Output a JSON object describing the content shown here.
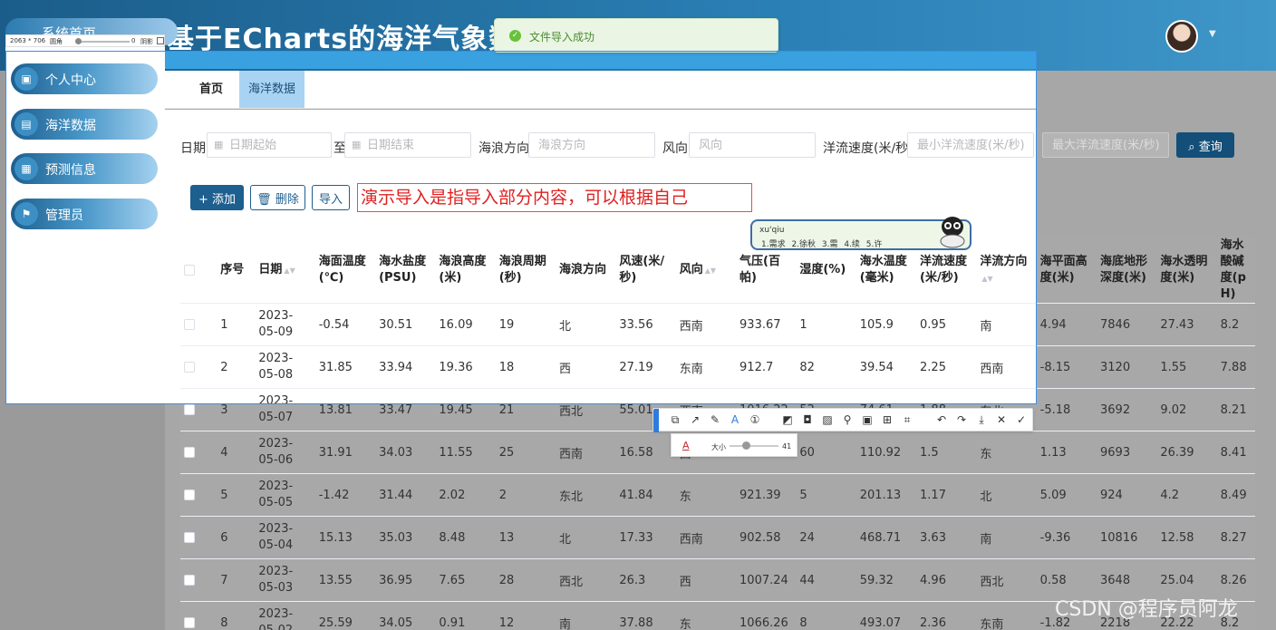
{
  "app": {
    "title": "基于ECharts的海洋气象数据",
    "title_suffix": "。"
  },
  "screenshot_tool": {
    "size_label": "2063 * 706",
    "round_label": "圆角",
    "round_value": "0",
    "shadow_label": "阴影",
    "brush_size_label": "大小",
    "brush_size_value": "41"
  },
  "toast": {
    "message": "文件导入成功",
    "color": "#67c23a"
  },
  "sidebar": {
    "home": "系统首页",
    "items": [
      {
        "label": "个人中心",
        "icon": "profile-icon"
      },
      {
        "label": "海洋数据",
        "icon": "clipboard-icon"
      },
      {
        "label": "预测信息",
        "icon": "grid-icon"
      },
      {
        "label": "管理员",
        "icon": "flag-icon"
      }
    ]
  },
  "tabs": [
    {
      "label": "首页",
      "active": false
    },
    {
      "label": "海洋数据",
      "active": true
    }
  ],
  "filters": {
    "date_label": "日期",
    "date_start_placeholder": "日期起始",
    "date_to": "至",
    "date_end_placeholder": "日期结束",
    "wave_dir_label": "海浪方向",
    "wave_dir_placeholder": "海浪方向",
    "wind_dir_label": "风向",
    "wind_dir_placeholder": "风向",
    "current_speed_label": "洋流速度(米/秒)",
    "min_current_placeholder": "最小洋流速度(米/秒)",
    "max_current_placeholder": "最大洋流速度(米/秒)",
    "query_button": "查询"
  },
  "actions": {
    "add": "添加",
    "delete": "删除",
    "import": "导入",
    "annotation": "演示导入是指导入部分内容，可以根据自己"
  },
  "ime": {
    "pinyin": "xu'qiu",
    "candidates": "1.需求  2.徐秋  3.需  4.续  5.许"
  },
  "table": {
    "headers": [
      "序号",
      "日期",
      "海面温度(℃)",
      "海水盐度(PSU)",
      "海浪高度(米)",
      "海浪周期(秒)",
      "海浪方向",
      "风速(米/秒)",
      "风向",
      "气压(百帕)",
      "湿度(%)",
      "海水温度(毫米)",
      "洋流速度(米/秒)",
      "洋流方向",
      "海平面高度(米)",
      "海底地形深度(米)",
      "海水透明度(米)",
      "海水酸碱度(pH)"
    ],
    "rows": [
      [
        "1",
        "2023-05-09",
        "-0.54",
        "30.51",
        "16.09",
        "19",
        "北",
        "33.56",
        "西南",
        "933.67",
        "1",
        "105.9",
        "0.95",
        "南",
        "4.94",
        "7846",
        "27.43",
        "8.2"
      ],
      [
        "2",
        "2023-05-08",
        "31.85",
        "33.94",
        "19.36",
        "18",
        "西",
        "27.19",
        "东南",
        "912.7",
        "82",
        "39.54",
        "2.25",
        "西南",
        "-8.15",
        "3120",
        "1.55",
        "7.88"
      ],
      [
        "3",
        "2023-05-07",
        "13.81",
        "33.47",
        "19.45",
        "21",
        "西北",
        "55.01",
        "西南",
        "1016.22",
        "52",
        "74.61",
        "1.88",
        "东北",
        "-5.18",
        "3692",
        "9.02",
        "8.21"
      ],
      [
        "4",
        "2023-05-06",
        "31.91",
        "34.03",
        "11.55",
        "25",
        "西南",
        "16.58",
        "西",
        "1077",
        "60",
        "110.92",
        "1.5",
        "东",
        "1.13",
        "9693",
        "26.39",
        "8.41"
      ],
      [
        "5",
        "2023-05-05",
        "-1.42",
        "31.44",
        "2.02",
        "2",
        "东北",
        "41.84",
        "东",
        "921.39",
        "5",
        "201.13",
        "1.17",
        "北",
        "5.09",
        "924",
        "4.2",
        "8.49"
      ],
      [
        "6",
        "2023-05-04",
        "15.13",
        "35.03",
        "8.48",
        "13",
        "北",
        "17.33",
        "西南",
        "902.58",
        "24",
        "468.71",
        "3.63",
        "南",
        "-9.36",
        "10816",
        "12.58",
        "8.27"
      ],
      [
        "7",
        "2023-05-03",
        "13.55",
        "36.95",
        "7.65",
        "28",
        "西北",
        "26.3",
        "西",
        "1007.24",
        "44",
        "59.32",
        "4.96",
        "西北",
        "0.58",
        "3648",
        "25.04",
        "8.26"
      ],
      [
        "8",
        "2023-05-02",
        "25.59",
        "34.05",
        "0.91",
        "12",
        "南",
        "37.88",
        "东",
        "1066.26",
        "8",
        "493.07",
        "2.36",
        "东南",
        "-1.82",
        "2218",
        "22.22",
        "8.2"
      ]
    ]
  },
  "watermark": "CSDN @程序员阿龙",
  "colors": {
    "primary": "#1d5f8e",
    "tab_active": "#a9d3f3",
    "annotation_red": "#e02020"
  }
}
